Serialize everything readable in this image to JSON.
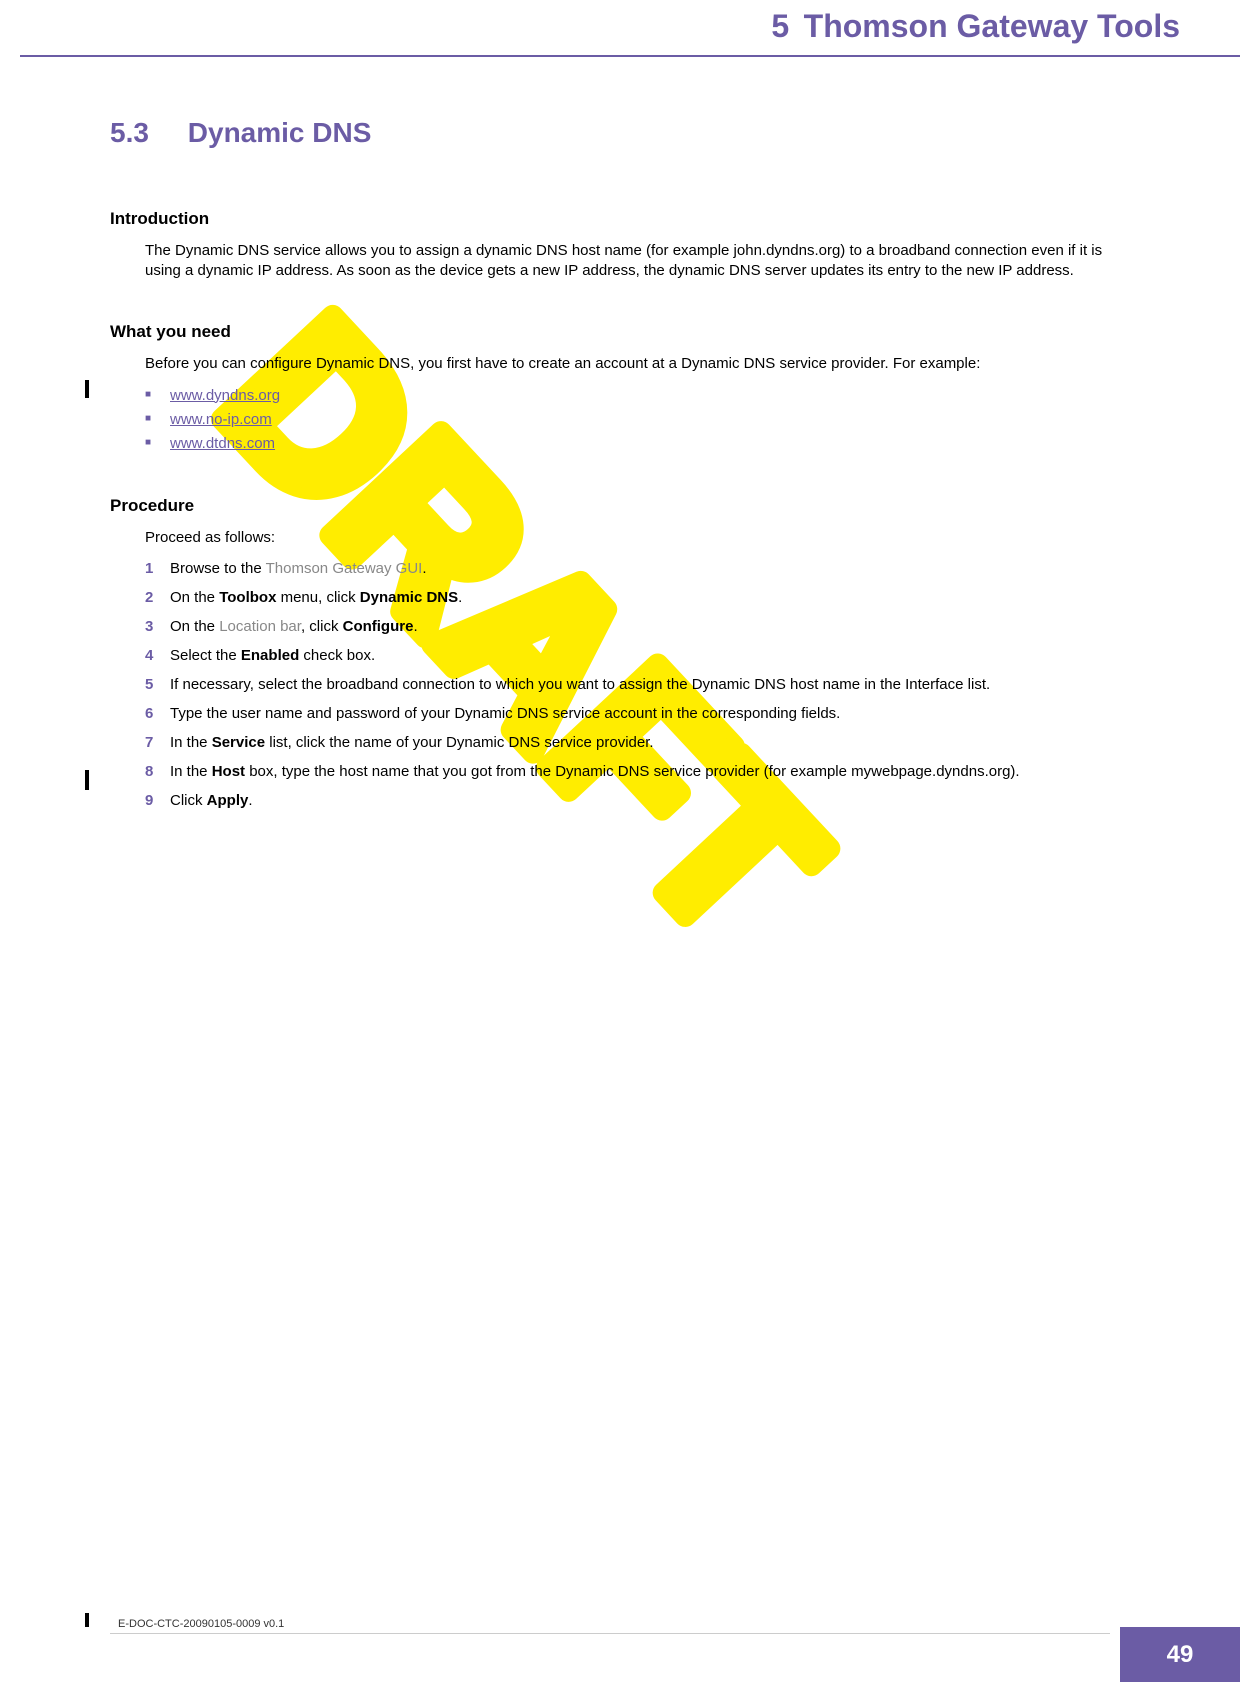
{
  "header": {
    "chapter_number": "5",
    "chapter_title": "Thomson Gateway Tools"
  },
  "section": {
    "number": "5.3",
    "title": "Dynamic DNS"
  },
  "intro": {
    "heading": "Introduction",
    "text": "The Dynamic DNS service allows you to assign a dynamic DNS host name (for example john.dyndns.org) to a broadband connection even if it is using a dynamic IP address. As soon as the device gets a new IP address, the dynamic DNS server updates its entry to the new IP address."
  },
  "need": {
    "heading": "What you need",
    "text": "Before you can configure Dynamic DNS, you first have to create an account at a Dynamic DNS service provider. For example:",
    "links": [
      "www.dyndns.org",
      "www.no-ip.com",
      "www.dtdns.com"
    ]
  },
  "procedure": {
    "heading": "Procedure",
    "lead": "Proceed as follows:",
    "steps": [
      {
        "num": "1",
        "pre": "Browse to the ",
        "link": "Thomson Gateway GUI",
        "post": "."
      },
      {
        "num": "2",
        "html": "On the <b>Toolbox</b> menu, click <b>Dynamic DNS</b>."
      },
      {
        "num": "3",
        "pre": "On the ",
        "soft": "Location bar",
        "mid": ", click ",
        "bold": "Configure",
        "post": "."
      },
      {
        "num": "4",
        "html": "Select the <b>Enabled</b> check box."
      },
      {
        "num": "5",
        "html": "If necessary, select the broadband connection to which you want to assign the Dynamic DNS host name in the Interface list."
      },
      {
        "num": "6",
        "html": "Type the user name and password of your Dynamic DNS service account in the corresponding fields."
      },
      {
        "num": "7",
        "html": "In the <b>Service</b> list, click the name of your Dynamic DNS service provider."
      },
      {
        "num": "8",
        "html": "In the <b>Host</b> box, type the host name that you got from the Dynamic DNS service provider (for example mywebpage.dyndns.org)."
      },
      {
        "num": "9",
        "html": "Click <b>Apply</b>."
      }
    ]
  },
  "footer": {
    "doc_id": "E-DOC-CTC-20090105-0009 v0.1",
    "page": "49"
  },
  "watermark": "DRAFT"
}
